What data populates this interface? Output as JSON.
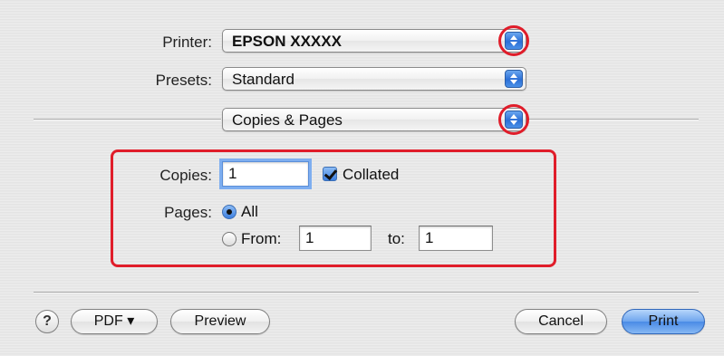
{
  "printer": {
    "label": "Printer:",
    "value": "EPSON XXXXX"
  },
  "presets": {
    "label": "Presets:",
    "value": "Standard"
  },
  "panel": {
    "value": "Copies & Pages"
  },
  "copies": {
    "label": "Copies:",
    "value": "1",
    "collated_label": "Collated",
    "collated": true
  },
  "pages": {
    "label": "Pages:",
    "all_label": "All",
    "from_label": "From:",
    "from_value": "1",
    "to_label": "to:",
    "to_value": "1",
    "selected": "All"
  },
  "footer": {
    "help": "?",
    "pdf": "PDF ▾",
    "preview": "Preview",
    "cancel": "Cancel",
    "print": "Print"
  },
  "colors": {
    "highlight": "#e01d2a",
    "accent": "#3d7fe0"
  }
}
